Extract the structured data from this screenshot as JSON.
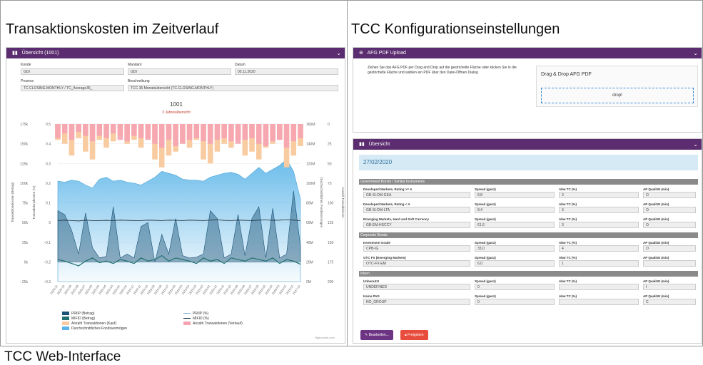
{
  "captions": {
    "left": "Transaktionskosten im Zeitverlauf",
    "right": "TCC Konfigurationseinstellungen",
    "bottom": "TCC Web-Interface"
  },
  "left_panel": {
    "header": "Übersicht (1001)",
    "fields": {
      "konde_label": "Konde",
      "konde_value": "GDI",
      "mandant_label": "Mandant",
      "mandant_value": "GDI",
      "datum_label": "Datum",
      "datum_value": "05.11.2020",
      "prozess_label": "Prozess",
      "prozess_value": "TC.CLOSING.MONTHLY / TC_Average35_",
      "beschreibung_label": "Beschreibung",
      "beschreibung_value": "TCC 35 Monatsübersicht (TC.CLOSING.MONTHLY)"
    },
    "chart_title": "1001",
    "chart_subtitle": "3 Jahresübersicht",
    "credit": "Highcharts.com",
    "legend": {
      "prip_betrag": "PRIIP (Betrag)",
      "mifid_betrag": "MIFID (Betrag)",
      "anzahl_kauf": "Anzahl Transaktionen (Kauf)",
      "fondsvermoegen": "Durchschnittliches Fondsvermögen",
      "prip_pct": "PRIIP (%)",
      "mifid_pct": "MIFID (%)",
      "anzahl_verkauf": "Anzahl Transaktionen (Verkauf)"
    }
  },
  "chart_data": {
    "type": "area",
    "title": "1001",
    "subtitle": "3 Jahresübersicht",
    "y_axes": {
      "left1_ticks": [
        "175k",
        "150k",
        "125k",
        "100k",
        "75k",
        "50k",
        "25k",
        "0k",
        "−25k"
      ],
      "left2_ticks": [
        "0.5",
        "0.4",
        "0.3",
        "0.2",
        "0.1",
        "0",
        "−0.1",
        "−0.2",
        "−0.3"
      ],
      "right1_ticks": [
        "160M",
        "140M",
        "120M",
        "100M",
        "80M",
        "60M",
        "40M",
        "20M",
        "0M"
      ],
      "right2_ticks": [
        "0",
        "25",
        "50",
        "75",
        "100",
        "125",
        "150",
        "175",
        "200"
      ],
      "left1_label": "Transaktionskosten (Betrag)",
      "left2_label": "Transaktionskosten (%)",
      "right1_label": "Durchschnittliches Fondsvermögen",
      "right2_label": "Anzahl Transaktionen"
    },
    "x_labels": [
      "2020-11",
      "2020-10",
      "2020-09",
      "2020-08",
      "2020-07",
      "2020-06",
      "2020-05",
      "2020-04",
      "2020-03",
      "2020-02",
      "2020-01",
      "2019-12",
      "2019-11",
      "2019-10",
      "2019-09",
      "2019-08",
      "2019-07",
      "2019-06",
      "2019-05",
      "2019-04",
      "2019-03",
      "2019-02",
      "2019-01",
      "2018-12",
      "2018-11",
      "2018-10",
      "2018-09",
      "2018-08",
      "2018-07",
      "2018-06",
      "2018-05",
      "2018-04",
      "2018-03",
      "2018-02",
      "2018-01",
      "2017-12"
    ],
    "fondsvermoegen_M": [
      102,
      101,
      103,
      102,
      98,
      95,
      104,
      106,
      102,
      103,
      101,
      100,
      98,
      102,
      106,
      112,
      110,
      108,
      104,
      103,
      103,
      102,
      106,
      108,
      110,
      111,
      109,
      104,
      110,
      116,
      110,
      114,
      118,
      124,
      112,
      84
    ],
    "kauf": [
      20,
      25,
      40,
      18,
      35,
      45,
      20,
      30,
      22,
      15,
      25,
      20,
      30,
      18,
      45,
      55,
      40,
      35,
      25,
      30,
      20,
      45,
      50,
      35,
      25,
      30,
      20,
      40,
      35,
      45,
      30,
      25,
      20,
      55,
      40,
      28
    ],
    "verkauf": [
      18,
      12,
      20,
      10,
      15,
      22,
      15,
      18,
      12,
      20,
      22,
      15,
      18,
      20,
      25,
      30,
      20,
      28,
      25,
      20,
      18,
      22,
      25,
      20,
      18,
      22,
      25,
      20,
      18,
      25,
      28,
      22,
      20,
      30,
      22,
      18
    ],
    "prip_betrag_k": [
      65,
      60,
      40,
      10,
      62,
      18,
      5,
      7,
      70,
      5,
      10,
      5,
      45,
      50,
      0,
      35,
      10,
      55,
      8,
      5,
      6,
      10,
      65,
      55,
      5,
      10,
      60,
      8,
      55,
      70,
      5,
      68,
      5,
      10,
      90,
      20
    ],
    "mifid_betrag_k": [
      20,
      18,
      15,
      12,
      18,
      22,
      16,
      18,
      15,
      20,
      18,
      15,
      22,
      18,
      20,
      25,
      18,
      22,
      20,
      18,
      15,
      22,
      18,
      20,
      15,
      22,
      20,
      18,
      22,
      20,
      18,
      22,
      15,
      20,
      18,
      14
    ],
    "mifid_pct": [
      0.01,
      0.012,
      0.01,
      0.008,
      0.012,
      0.01,
      0.01,
      0.011,
      0.01,
      0.012,
      0.011,
      0.01,
      0.01,
      0.012,
      0.011,
      0.01,
      0.012,
      0.011,
      0.01,
      0.012,
      0.011,
      0.01,
      0.012,
      0.013,
      0.011,
      0.01,
      0.012,
      0.011,
      0.01,
      0.012,
      0.013,
      0.011,
      0.012,
      0.014,
      0.012,
      0.01
    ]
  },
  "afg_panel": {
    "header": "AFG PDF Upload",
    "instructions": "Ziehen Sie das AFG PDF per Drag and Drop auf die gestrichelte Fläche oder klicken Sie in die gestrichelte Fläche und wählen ein PDF über den Datei-Öffnen Dialog",
    "drop_title": "Drag & Drop AFG PDF",
    "drop_text": "drop!"
  },
  "overview_panel": {
    "header": "Übersicht",
    "date": "27/02/2020",
    "col_spread": "Spread (ganz)",
    "col_abw": "Abw TC (%)",
    "col_ap": "AP Qualität (min)",
    "groups": [
      {
        "title": "Government Bonds / Similar Instruments",
        "rows": [
          {
            "label": "Developed Markets, Rating >= A",
            "code": "GB-SI-DM-GEA",
            "spread": "8,8",
            "abw": "3",
            "ap": "O"
          },
          {
            "label": "Developed Markets, Rating < A",
            "code": "GB-SI-DM-LTA",
            "spread": "8,4",
            "abw": "3",
            "ap": "O"
          },
          {
            "label": "Emerging Markets, Hard and Soft Currency",
            "code": "GB-EM-HSCCY",
            "spread": "61,6",
            "abw": "3",
            "ap": "O"
          }
        ]
      },
      {
        "title": "Corporate Bonds",
        "rows": [
          {
            "label": "Investment Grade",
            "code": "CPB-IG",
            "spread": "33,0",
            "abw": "4",
            "ap": "O"
          },
          {
            "label": "OTC FX (Emerging Markets)",
            "code": "OTC-FX-EM",
            "spread": "6,0",
            "abw": "1",
            "ap": ""
          }
        ]
      },
      {
        "title": "Intern",
        "rows": [
          {
            "label": "Unbenutzt",
            "code": "UNDEFINED",
            "spread": "0",
            "abw": "",
            "ap": "I"
          },
          {
            "label": "Keine PAG",
            "code": "NO_GROUP",
            "spread": "0",
            "abw": "",
            "ap": "C"
          }
        ]
      }
    ],
    "btn_edit": "Bearbeiten...",
    "btn_release": "Freigeben"
  },
  "colors": {
    "header_purple": "#5b2c6f",
    "fonds_blue": "#5bb5e8",
    "prip_dark": "#1a5276",
    "mifid_teal": "#1f6f6f",
    "kauf_peach": "#f8cba0",
    "verkauf_pink": "#f5a3b0",
    "btn_edit": "#6c3483",
    "btn_release": "#e74c3c"
  }
}
